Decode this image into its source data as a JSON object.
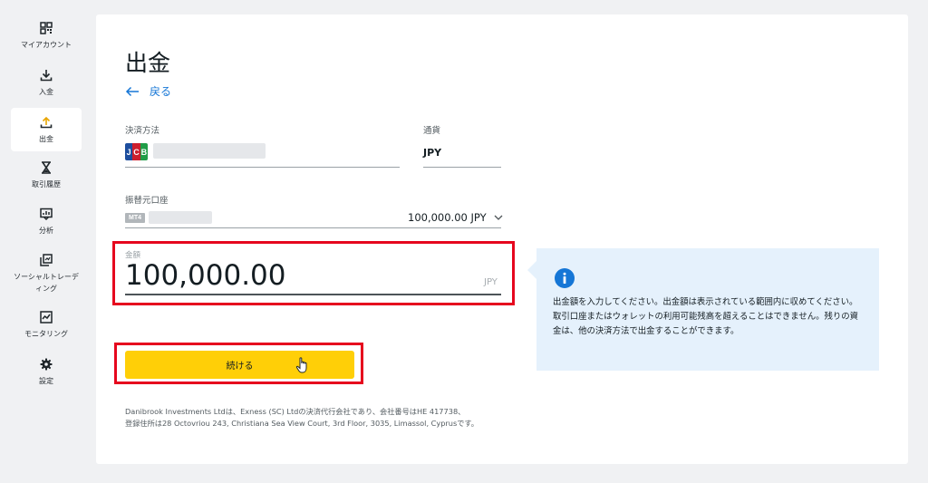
{
  "sidebar": {
    "items": [
      {
        "label": "マイアカウント",
        "icon": "my-account-icon"
      },
      {
        "label": "入金",
        "icon": "deposit-icon"
      },
      {
        "label": "出金",
        "icon": "withdrawal-icon",
        "active": true
      },
      {
        "label": "取引履歴",
        "icon": "history-icon"
      },
      {
        "label": "分析",
        "icon": "analytics-icon"
      },
      {
        "label": "ソーシャルトレーディング",
        "label_line1": "ソーシャルトレーデ",
        "label_line2": "ィング",
        "icon": "social-trading-icon"
      },
      {
        "label": "モニタリング",
        "icon": "monitoring-icon"
      },
      {
        "label": "設定",
        "icon": "settings-icon"
      }
    ]
  },
  "main": {
    "title": "出金",
    "back_label": "戻る",
    "payment_method": {
      "label": "決済方法",
      "card_brand": "JCB"
    },
    "currency": {
      "label": "通貨",
      "value": "JPY"
    },
    "source_account": {
      "label": "振替元口座",
      "badge": "MT4",
      "balance": "100,000.00 JPY"
    },
    "amount": {
      "label": "金額",
      "value": "100,000.00",
      "unit": "JPY"
    },
    "continue_label": "続ける",
    "info_text": "出金額を入力してください。出金額は表示されている範囲内に収めてください。取引口座またはウォレットの利用可能残高を超えることはできません。残りの資金は、他の決済方法で出金することができます。",
    "footer_line1": "Danibrook Investments Ltdは、Exness (SC) Ltdの決済代行会社であり、会社番号はHE 417738、",
    "footer_line2": "登録住所は28 Octovriou 243, Christiana Sea View Court, 3rd Floor, 3035, Limassol, Cyprusです。"
  },
  "colors": {
    "accent_blue": "#1576d6",
    "button_yellow": "#ffcf07",
    "highlight_red": "#e6071e",
    "info_bg": "#e5f1fc"
  }
}
